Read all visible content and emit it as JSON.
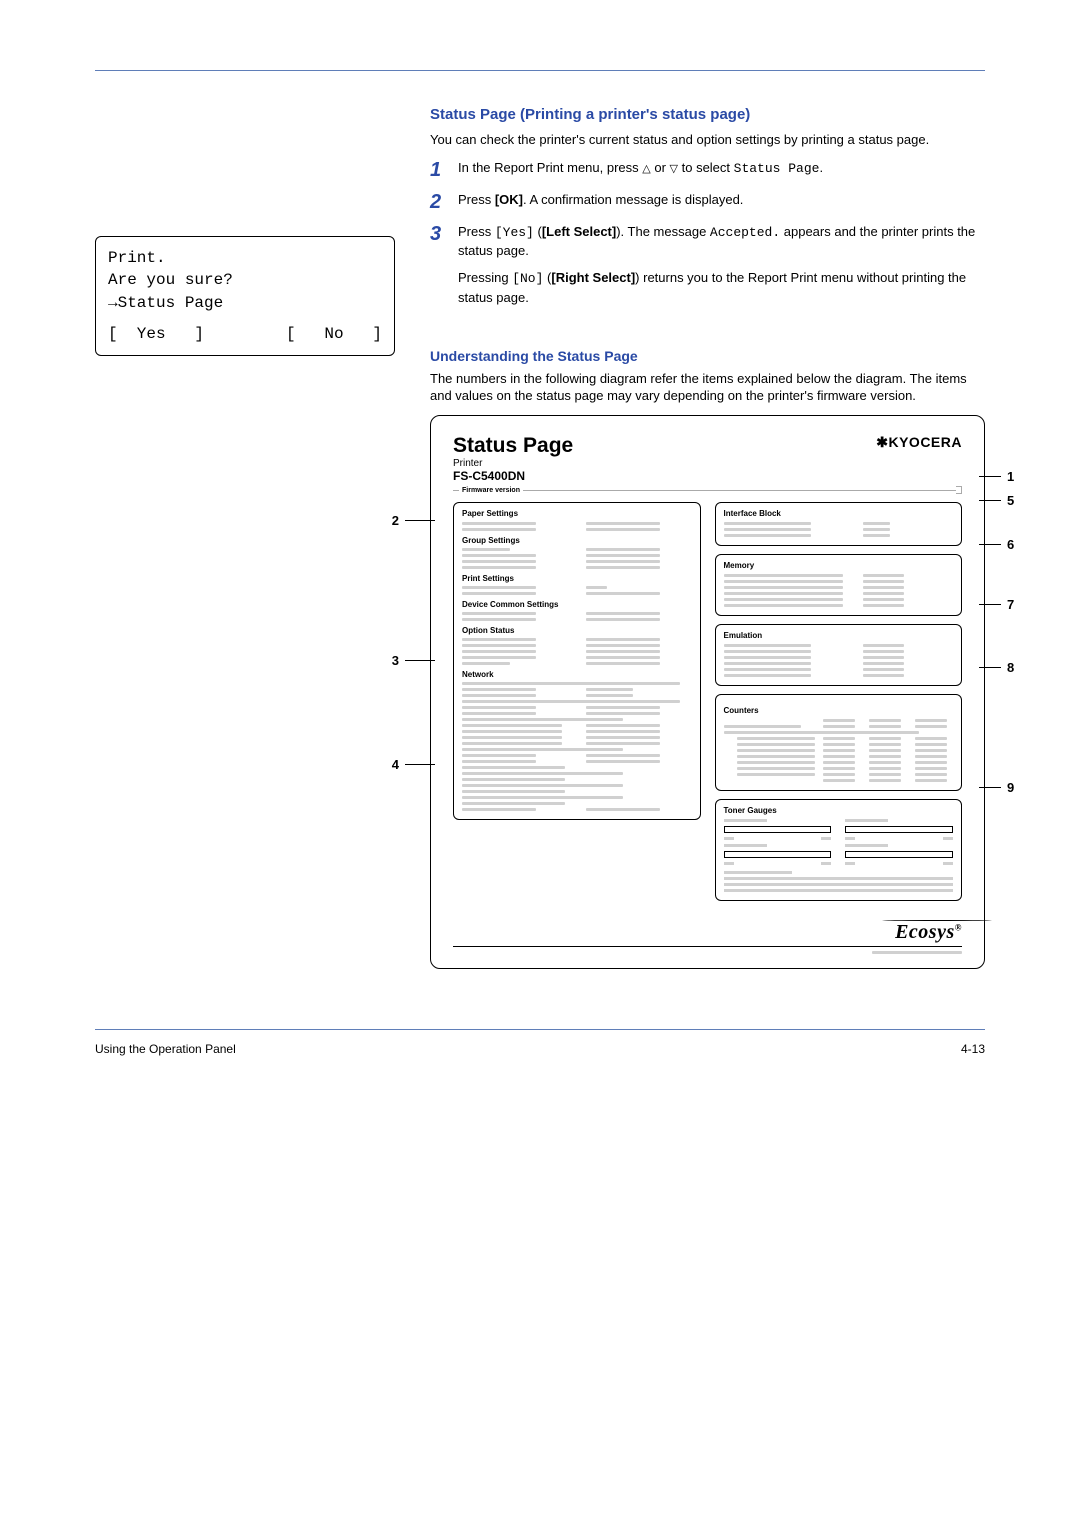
{
  "lcd": {
    "line1": "Print.",
    "line2": "Are you sure?",
    "line3": "→Status Page",
    "yes": "[  Yes   ]",
    "no": "[   No   ]"
  },
  "section": {
    "title": "Status Page (Printing a printer's status page)",
    "intro": "You can check the printer's current status and option settings by printing a status page."
  },
  "steps": {
    "s1": {
      "num": "1",
      "pre": "In the Report Print menu, press ",
      "tri_up": "△",
      "mid": " or ",
      "tri_down": "▽",
      "post": " to select ",
      "mono": "Status Page",
      "end": "."
    },
    "s2": {
      "num": "2",
      "pre": "Press ",
      "bold": "[OK]",
      "post": ". A confirmation message is displayed."
    },
    "s3": {
      "num": "3",
      "pre": "Press ",
      "mono1": "[Yes]",
      "mid1": " (",
      "bold1": "[Left Select]",
      "post1": "). The message ",
      "mono2": "Accepted.",
      "post2": " appears and the printer prints the status page.",
      "sub_pre": "Pressing ",
      "sub_mono": "[No]",
      "sub_mid": " (",
      "sub_bold": "[Right Select]",
      "sub_post": ") returns you to the Report Print menu without printing the status page."
    }
  },
  "understanding": {
    "title": "Understanding the Status Page",
    "para": "The numbers in the following diagram refer the items explained below the diagram. The items and values on the status page may vary depending on the printer's firmware version."
  },
  "sheet": {
    "title": "Status Page",
    "sub_label": "Printer",
    "model": "FS-C5400DN",
    "brand": "KYOCERA",
    "fw": "Firmware version",
    "panels": {
      "paper": "Paper Settings",
      "group": "Group Settings",
      "print": "Print Settings",
      "device": "Device Common Settings",
      "option": "Option Status",
      "network": "Network",
      "interface": "Interface Block",
      "memory": "Memory",
      "emulation": "Emulation",
      "counters": "Counters",
      "toner": "Toner Gauges"
    },
    "ecosys": "Ecosys",
    "reg": "®"
  },
  "callouts": {
    "c1": "1",
    "c2": "2",
    "c3": "3",
    "c4": "4",
    "c5": "5",
    "c6": "6",
    "c7": "7",
    "c8": "8",
    "c9": "9"
  },
  "footer": {
    "left": "Using the Operation Panel",
    "right": "4-13"
  }
}
